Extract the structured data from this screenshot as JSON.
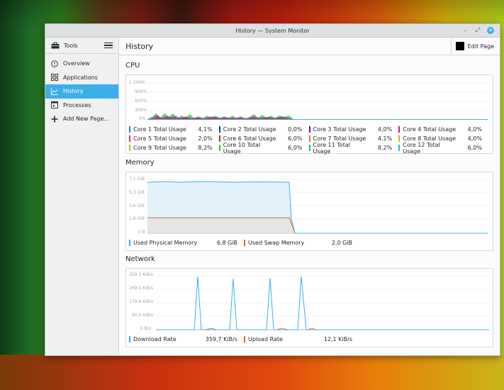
{
  "window": {
    "title": "History — System Monitor"
  },
  "sidebar": {
    "header": "Tools",
    "items": [
      {
        "label": "Overview",
        "icon": "overview-icon"
      },
      {
        "label": "Applications",
        "icon": "applications-icon"
      },
      {
        "label": "History",
        "icon": "history-icon",
        "active": true
      },
      {
        "label": "Processes",
        "icon": "processes-icon"
      },
      {
        "label": "Add New Page...",
        "icon": "add-icon"
      }
    ]
  },
  "page": {
    "title": "History",
    "edit_label": "Edit Page"
  },
  "cpu": {
    "title": "CPU",
    "y_ticks": [
      "1 200%",
      "900%",
      "600%",
      "300%",
      "0%"
    ],
    "legend": [
      {
        "name": "Core 1 Total Usage",
        "value": "4,1%",
        "color": "#2a7fbf"
      },
      {
        "name": "Core 2 Total Usage",
        "value": "0,0%",
        "color": "#1d3b8f"
      },
      {
        "name": "Core 3 Total Usage",
        "value": "4,0%",
        "color": "#4d1fa3"
      },
      {
        "name": "Core 4 Total Usage",
        "value": "4,0%",
        "color": "#b01c9e"
      },
      {
        "name": "Core 5 Total Usage",
        "value": "2,0%",
        "color": "#d6336b"
      },
      {
        "name": "Core 6 Total Usage",
        "value": "6,0%",
        "color": "#c62828"
      },
      {
        "name": "Core 7 Total Usage",
        "value": "4,1%",
        "color": "#e0771c"
      },
      {
        "name": "Core 8 Total Usage",
        "value": "4,0%",
        "color": "#d4b516"
      },
      {
        "name": "Core 9 Total Usage",
        "value": "8,2%",
        "color": "#8fcf2a"
      },
      {
        "name": "Core 10 Total Usage",
        "value": "6,0%",
        "color": "#2ebf3e"
      },
      {
        "name": "Core 11 Total Usage",
        "value": "8,2%",
        "color": "#1fb57a"
      },
      {
        "name": "Core 12 Total Usage",
        "value": "6,0%",
        "color": "#27b3c9"
      }
    ]
  },
  "memory": {
    "title": "Memory",
    "y_ticks": [
      "7,1 GiB",
      "5,3 GiB",
      "3,6 GiB",
      "1,8 GiB",
      "0 B"
    ],
    "legend": [
      {
        "name": "Used Physical Memory",
        "value": "6,8 GiB",
        "color": "#3daee9"
      },
      {
        "name": "Used Swap Memory",
        "value": "2,0 GiB",
        "color": "#c0703c"
      }
    ]
  },
  "network": {
    "title": "Network",
    "y_ticks": [
      "359,3 KiB/s",
      "269,5 KiB/s",
      "179,6 KiB/s",
      "90,0 KiB/s",
      "0 B/s"
    ],
    "legend": [
      {
        "name": "Download Rate",
        "value": "359,7 KiB/s",
        "color": "#3daee9"
      },
      {
        "name": "Upload Rate",
        "value": "12,1 KiB/s",
        "color": "#c0703c"
      }
    ]
  }
}
